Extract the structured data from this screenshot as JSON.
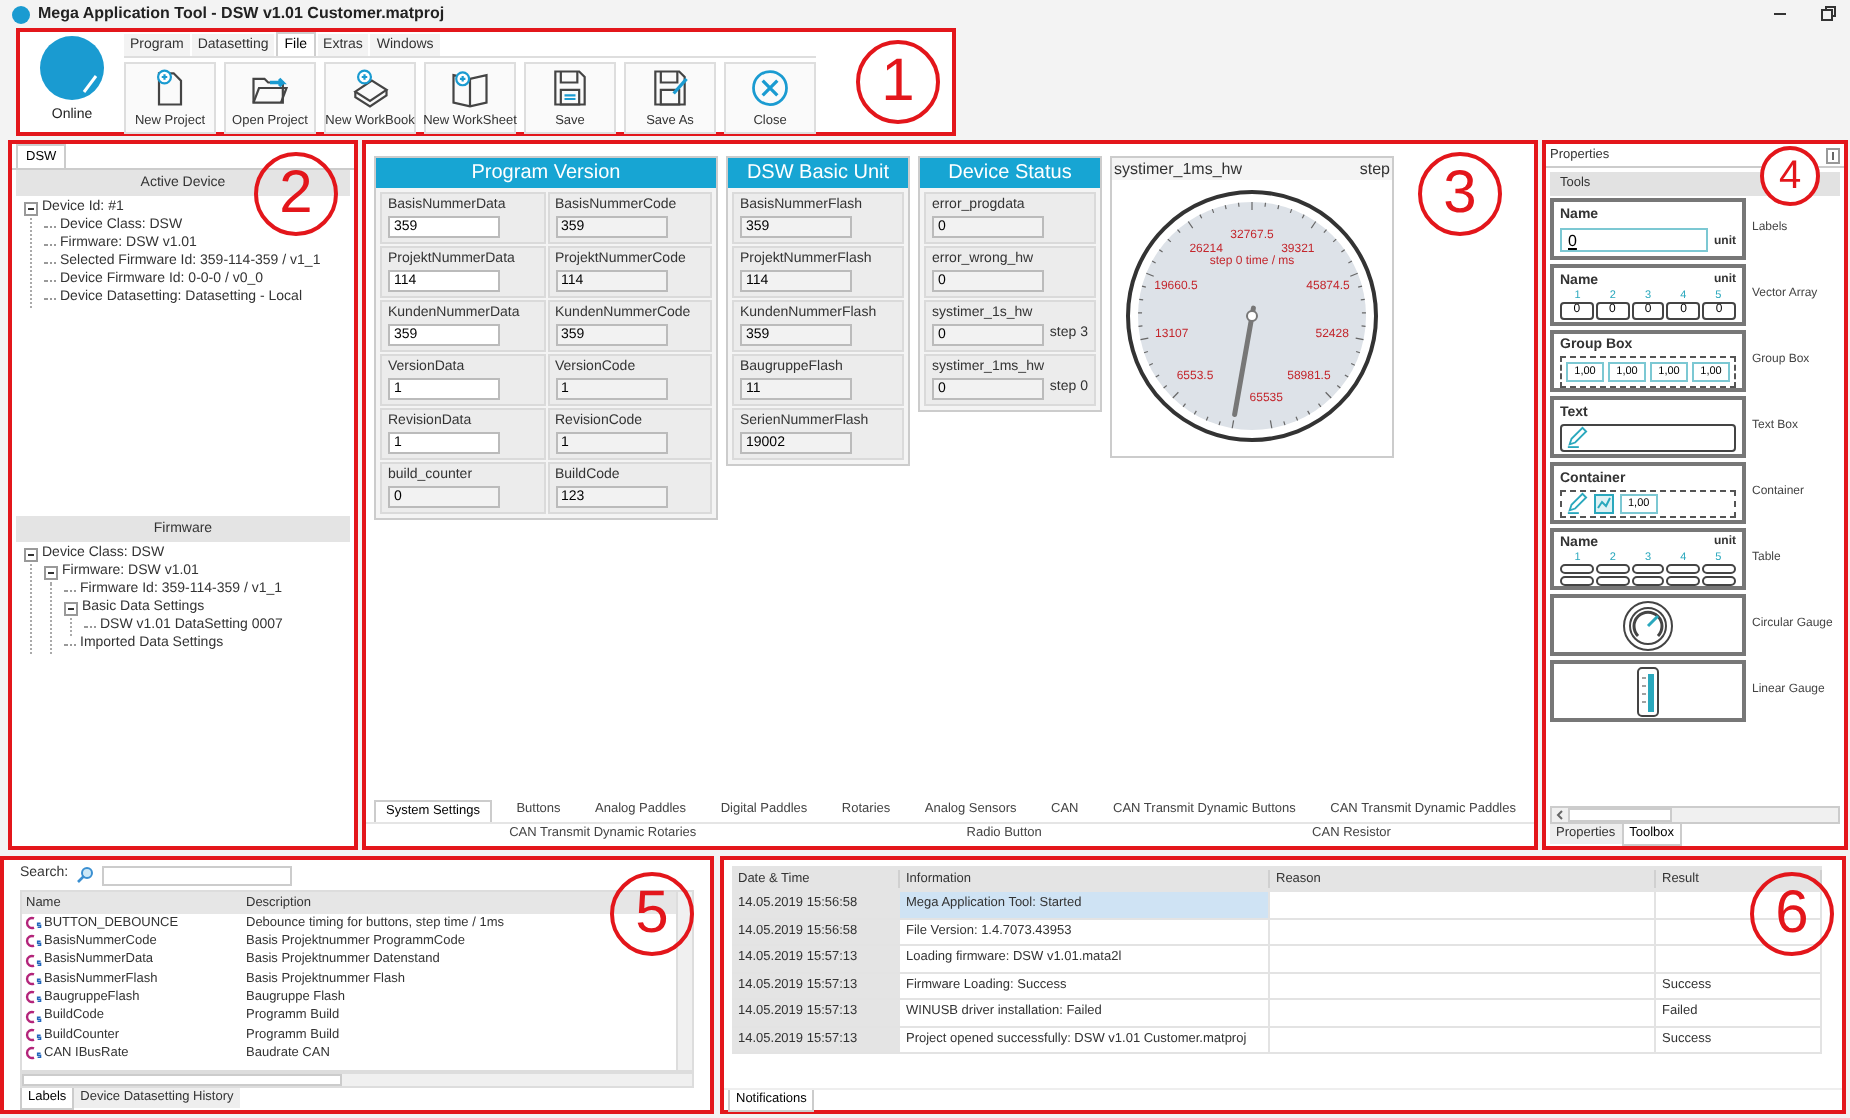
{
  "window": {
    "title": "Mega Application Tool - DSW v1.01 Customer.matproj"
  },
  "ribbon": {
    "callout": "1",
    "online": {
      "label": "Online"
    },
    "menu": [
      {
        "label": "Program",
        "selected": false
      },
      {
        "label": "Datasetting",
        "selected": false
      },
      {
        "label": "File",
        "selected": true
      },
      {
        "label": "Extras",
        "selected": false
      },
      {
        "label": "Windows",
        "selected": false
      }
    ],
    "buttons": [
      {
        "label": "New Project",
        "kind": "new-project"
      },
      {
        "label": "Open Project",
        "kind": "open-project"
      },
      {
        "label": "New WorkBook",
        "kind": "new-workbook"
      },
      {
        "label": "New WorkSheet",
        "kind": "new-worksheet"
      },
      {
        "label": "Save",
        "kind": "save"
      },
      {
        "label": "Save As",
        "kind": "save-as"
      },
      {
        "label": "Close",
        "kind": "close"
      }
    ]
  },
  "device_panel": {
    "callout": "2",
    "tab": "DSW",
    "active_device": {
      "title": "Active Device",
      "tree": [
        {
          "label": "Device Id: #1",
          "expanded": true,
          "children": [
            {
              "label": "Device Class: DSW"
            },
            {
              "label": "Firmware: DSW v1.01"
            },
            {
              "label": "Selected Firmware Id: 359-114-359 / v1_1"
            },
            {
              "label": "Device Firmware Id: 0-0-0 / v0_0"
            },
            {
              "label": "Device Datasetting: Datasetting - Local"
            }
          ]
        }
      ]
    },
    "firmware": {
      "title": "Firmware",
      "tree": [
        {
          "label": "Device Class: DSW",
          "expanded": true,
          "children": [
            {
              "label": "Firmware: DSW v1.01",
              "expanded": true,
              "children": [
                {
                  "label": "Firmware Id: 359-114-359 / v1_1"
                },
                {
                  "label": "Basic Data Settings",
                  "expanded": true,
                  "children": [
                    {
                      "label": "DSW v1.01 DataSetting 0007"
                    }
                  ]
                },
                {
                  "label": "Imported Data Settings"
                }
              ]
            }
          ]
        }
      ]
    }
  },
  "workspace": {
    "callout": "3",
    "groups": [
      {
        "title": "Program Version",
        "kind": "two-column",
        "fields": [
          {
            "label": "BasisNummerData",
            "value": "359",
            "readonly": false
          },
          {
            "label": "BasisNummerCode",
            "value": "359",
            "readonly": true
          },
          {
            "label": "ProjektNummerData",
            "value": "114",
            "readonly": false
          },
          {
            "label": "ProjektNummerCode",
            "value": "114",
            "readonly": true
          },
          {
            "label": "KundenNummerData",
            "value": "359",
            "readonly": false
          },
          {
            "label": "KundenNummerCode",
            "value": "359",
            "readonly": true
          },
          {
            "label": "VersionData",
            "value": "1",
            "readonly": false
          },
          {
            "label": "VersionCode",
            "value": "1",
            "readonly": true
          },
          {
            "label": "RevisionData",
            "value": "1",
            "readonly": false
          },
          {
            "label": "RevisionCode",
            "value": "1",
            "readonly": true
          },
          {
            "label": "build_counter",
            "value": "0",
            "readonly": true
          },
          {
            "label": "BuildCode",
            "value": "123",
            "readonly": true
          }
        ]
      },
      {
        "title": "DSW Basic Unit",
        "kind": "one-column",
        "fields": [
          {
            "label": "BasisNummerFlash",
            "value": "359",
            "readonly": true
          },
          {
            "label": "ProjektNummerFlash",
            "value": "114",
            "readonly": true
          },
          {
            "label": "KundenNummerFlash",
            "value": "359",
            "readonly": true
          },
          {
            "label": "BaugruppeFlash",
            "value": "11",
            "readonly": true
          },
          {
            "label": "SerienNummerFlash",
            "value": "19002",
            "readonly": true
          }
        ]
      },
      {
        "title": "Device Status",
        "kind": "one-column",
        "fields": [
          {
            "label": "error_progdata",
            "value": "0",
            "readonly": true
          },
          {
            "label": "error_wrong_hw",
            "value": "0",
            "readonly": true
          },
          {
            "label": "systimer_1s_hw",
            "value": "0",
            "readonly": true,
            "suffix": "step 3"
          },
          {
            "label": "systimer_1ms_hw",
            "value": "0",
            "readonly": true,
            "suffix": "step 0"
          }
        ]
      }
    ],
    "gauge": {
      "title": "systimer_1ms_hw",
      "step": "step",
      "caption": "step 0 time / ms",
      "labels": [
        "6553.5",
        "13107",
        "19660.5",
        "26214",
        "32767.5",
        "39321",
        "45874.5",
        "52428",
        "58981.5",
        "65535"
      ]
    },
    "tabs": [
      [
        {
          "label": "System Settings",
          "selected": true
        },
        {
          "label": "Buttons",
          "selected": false
        },
        {
          "label": "Analog Paddles",
          "selected": false
        },
        {
          "label": "Digital Paddles",
          "selected": false
        },
        {
          "label": "Rotaries",
          "selected": false
        },
        {
          "label": "Analog Sensors",
          "selected": false
        },
        {
          "label": "CAN",
          "selected": false
        },
        {
          "label": "CAN Transmit Dynamic Buttons",
          "selected": false
        },
        {
          "label": "CAN Transmit Dynamic Paddles",
          "selected": false
        }
      ],
      [
        {
          "label": "CAN Transmit Dynamic Rotaries",
          "selected": false
        },
        {
          "label": "Radio Button",
          "selected": false
        },
        {
          "label": "CAN Resistor",
          "selected": false
        }
      ]
    ]
  },
  "toolbox": {
    "callout": "4",
    "title": "Properties",
    "header": "Tools",
    "tools": [
      {
        "kind": "label",
        "title": "Name",
        "value": "0",
        "unit": "unit",
        "label": "Labels"
      },
      {
        "kind": "vector",
        "title": "Name",
        "unit": "unit",
        "indices": [
          "1",
          "2",
          "3",
          "4",
          "5"
        ],
        "values": [
          "0",
          "0",
          "0",
          "0",
          "0"
        ],
        "label": "Vector Array"
      },
      {
        "kind": "group",
        "title": "Group Box",
        "values": [
          "1,00",
          "1,00",
          "1,00",
          "1,00"
        ],
        "label": "Group Box"
      },
      {
        "kind": "text",
        "title": "Text",
        "label": "Text Box"
      },
      {
        "kind": "container",
        "title": "Container",
        "value": "1,00",
        "label": "Container"
      },
      {
        "kind": "table",
        "title": "Name",
        "unit": "unit",
        "indices": [
          "1",
          "2",
          "3",
          "4",
          "5"
        ],
        "label": "Table"
      },
      {
        "kind": "circular",
        "label": "Circular Gauge"
      },
      {
        "kind": "linear",
        "label": "Linear Gauge"
      }
    ],
    "tabs": [
      {
        "label": "Properties",
        "selected": false
      },
      {
        "label": "Toolbox",
        "selected": true
      }
    ]
  },
  "labels_panel": {
    "callout": "5",
    "search_label": "Search:",
    "columns": [
      "Name",
      "Description"
    ],
    "rows": [
      {
        "name": "BUTTON_DEBOUNCE",
        "description": "Debounce timing for buttons, step time / 1ms"
      },
      {
        "name": "BasisNummerCode",
        "description": "Basis Projektnummer ProgrammCode"
      },
      {
        "name": "BasisNummerData",
        "description": "Basis Projektnummer Datenstand"
      },
      {
        "name": "BasisNummerFlash",
        "description": "Basis Projektnummer Flash"
      },
      {
        "name": "BaugruppeFlash",
        "description": "Baugruppe Flash"
      },
      {
        "name": "BuildCode",
        "description": "Programm Build"
      },
      {
        "name": "BuildCounter",
        "description": "Programm Build"
      },
      {
        "name": "CAN IBusRate",
        "description": "Baudrate CAN"
      }
    ],
    "tabs": [
      {
        "label": "Labels",
        "selected": true
      },
      {
        "label": "Device Datasetting History",
        "selected": false
      }
    ]
  },
  "notifications": {
    "callout": "6",
    "columns": [
      "Date & Time",
      "Information",
      "Reason",
      "Result"
    ],
    "rows": [
      {
        "time": "14.05.2019 15:56:58",
        "info": "Mega Application Tool: Started",
        "selected": true
      },
      {
        "time": "14.05.2019 15:56:58",
        "info": "File Version: 1.4.7073.43953",
        "selected": false
      },
      {
        "time": "14.05.2019 15:57:13",
        "info": "Loading firmware: DSW v1.01.mata2l",
        "selected": false
      },
      {
        "time": "14.05.2019 15:57:13",
        "info": "Firmware Loading: Success",
        "result": "Success",
        "selected": false
      },
      {
        "time": "14.05.2019 15:57:13",
        "info": "WINUSB driver installation: Failed",
        "result": "Failed",
        "selected": false
      },
      {
        "time": "14.05.2019 15:57:13",
        "info": "Project opened successfully: DSW v1.01 Customer.matproj",
        "result": "Success",
        "selected": false
      }
    ],
    "tabs": [
      {
        "label": "Notifications",
        "selected": true
      }
    ]
  }
}
